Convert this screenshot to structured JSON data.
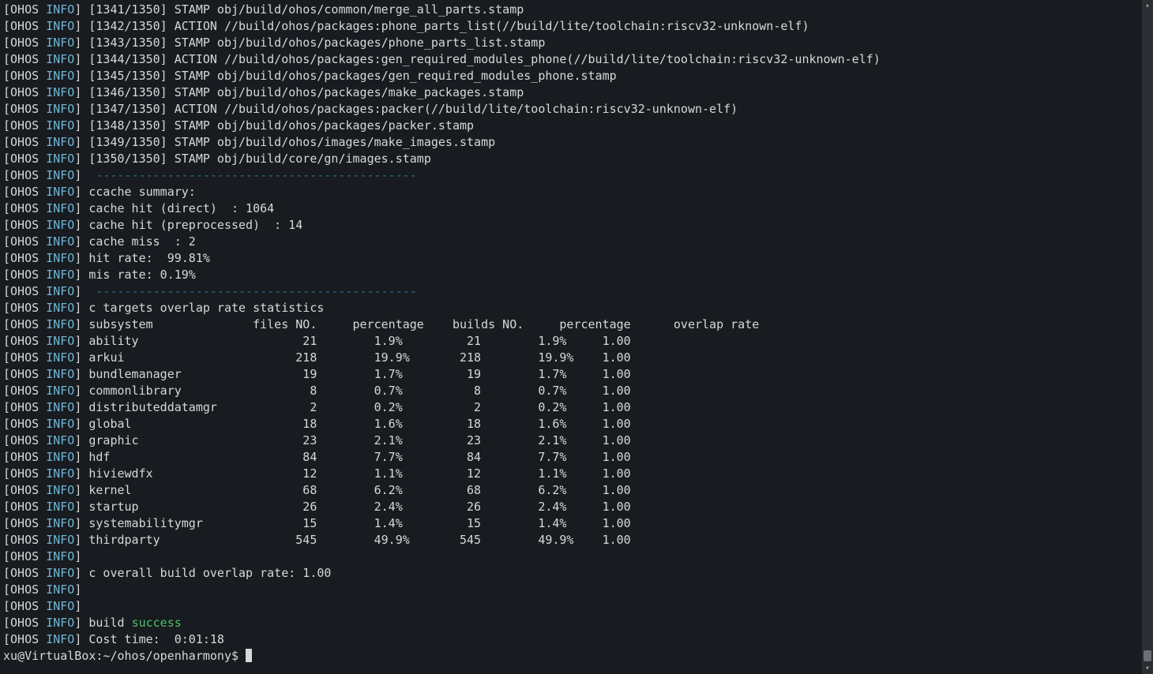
{
  "prefix": {
    "open": "[",
    "ohos": "OHOS",
    "sp": " ",
    "info": "INFO",
    "close": "]"
  },
  "build_lines": [
    "[1341/1350] STAMP obj/build/ohos/common/merge_all_parts.stamp",
    "[1342/1350] ACTION //build/ohos/packages:phone_parts_list(//build/lite/toolchain:riscv32-unknown-elf)",
    "[1343/1350] STAMP obj/build/ohos/packages/phone_parts_list.stamp",
    "[1344/1350] ACTION //build/ohos/packages:gen_required_modules_phone(//build/lite/toolchain:riscv32-unknown-elf)",
    "[1345/1350] STAMP obj/build/ohos/packages/gen_required_modules_phone.stamp",
    "[1346/1350] STAMP obj/build/ohos/packages/make_packages.stamp",
    "[1347/1350] ACTION //build/ohos/packages:packer(//build/lite/toolchain:riscv32-unknown-elf)",
    "[1348/1350] STAMP obj/build/ohos/packages/packer.stamp",
    "[1349/1350] STAMP obj/build/ohos/images/make_images.stamp",
    "[1350/1350] STAMP obj/build/core/gn/images.stamp"
  ],
  "separator": "---------------------------------------------",
  "ccache": {
    "title": "ccache summary:",
    "hit_direct": "cache hit (direct)  : 1064",
    "hit_preprocessed": "cache hit (preprocessed)  : 14",
    "miss": "cache miss  : 2",
    "hit_rate": "hit rate:  99.81%",
    "mis_rate": "mis rate: 0.19%"
  },
  "overlap_title": "c targets overlap rate statistics",
  "table_header": {
    "subsystem": "subsystem",
    "files_no": "files NO.",
    "percentage1": "percentage",
    "builds_no": "builds NO.",
    "percentage2": "percentage",
    "overlap": "overlap rate"
  },
  "rows": [
    {
      "subsystem": "ability",
      "files": "21",
      "p1": "1.9%",
      "builds": "21",
      "p2": "1.9%",
      "rate": "1.00"
    },
    {
      "subsystem": "arkui",
      "files": "218",
      "p1": "19.9%",
      "builds": "218",
      "p2": "19.9%",
      "rate": "1.00"
    },
    {
      "subsystem": "bundlemanager",
      "files": "19",
      "p1": "1.7%",
      "builds": "19",
      "p2": "1.7%",
      "rate": "1.00"
    },
    {
      "subsystem": "commonlibrary",
      "files": "8",
      "p1": "0.7%",
      "builds": "8",
      "p2": "0.7%",
      "rate": "1.00"
    },
    {
      "subsystem": "distributeddatamgr",
      "files": "2",
      "p1": "0.2%",
      "builds": "2",
      "p2": "0.2%",
      "rate": "1.00"
    },
    {
      "subsystem": "global",
      "files": "18",
      "p1": "1.6%",
      "builds": "18",
      "p2": "1.6%",
      "rate": "1.00"
    },
    {
      "subsystem": "graphic",
      "files": "23",
      "p1": "2.1%",
      "builds": "23",
      "p2": "2.1%",
      "rate": "1.00"
    },
    {
      "subsystem": "hdf",
      "files": "84",
      "p1": "7.7%",
      "builds": "84",
      "p2": "7.7%",
      "rate": "1.00"
    },
    {
      "subsystem": "hiviewdfx",
      "files": "12",
      "p1": "1.1%",
      "builds": "12",
      "p2": "1.1%",
      "rate": "1.00"
    },
    {
      "subsystem": "kernel",
      "files": "68",
      "p1": "6.2%",
      "builds": "68",
      "p2": "6.2%",
      "rate": "1.00"
    },
    {
      "subsystem": "startup",
      "files": "26",
      "p1": "2.4%",
      "builds": "26",
      "p2": "2.4%",
      "rate": "1.00"
    },
    {
      "subsystem": "systemabilitymgr",
      "files": "15",
      "p1": "1.4%",
      "builds": "15",
      "p2": "1.4%",
      "rate": "1.00"
    },
    {
      "subsystem": "thirdparty",
      "files": "545",
      "p1": "49.9%",
      "builds": "545",
      "p2": "49.9%",
      "rate": "1.00"
    }
  ],
  "overall": "c overall build overlap rate: 1.00",
  "build_word": " build ",
  "success_word": "success",
  "cost_time": "Cost time:  0:01:18",
  "prompt": {
    "user": "xu",
    "at": "@",
    "host": "VirtualBox",
    "colon": ":",
    "path": "~/ohos/openharmony",
    "dollar": "$ "
  }
}
